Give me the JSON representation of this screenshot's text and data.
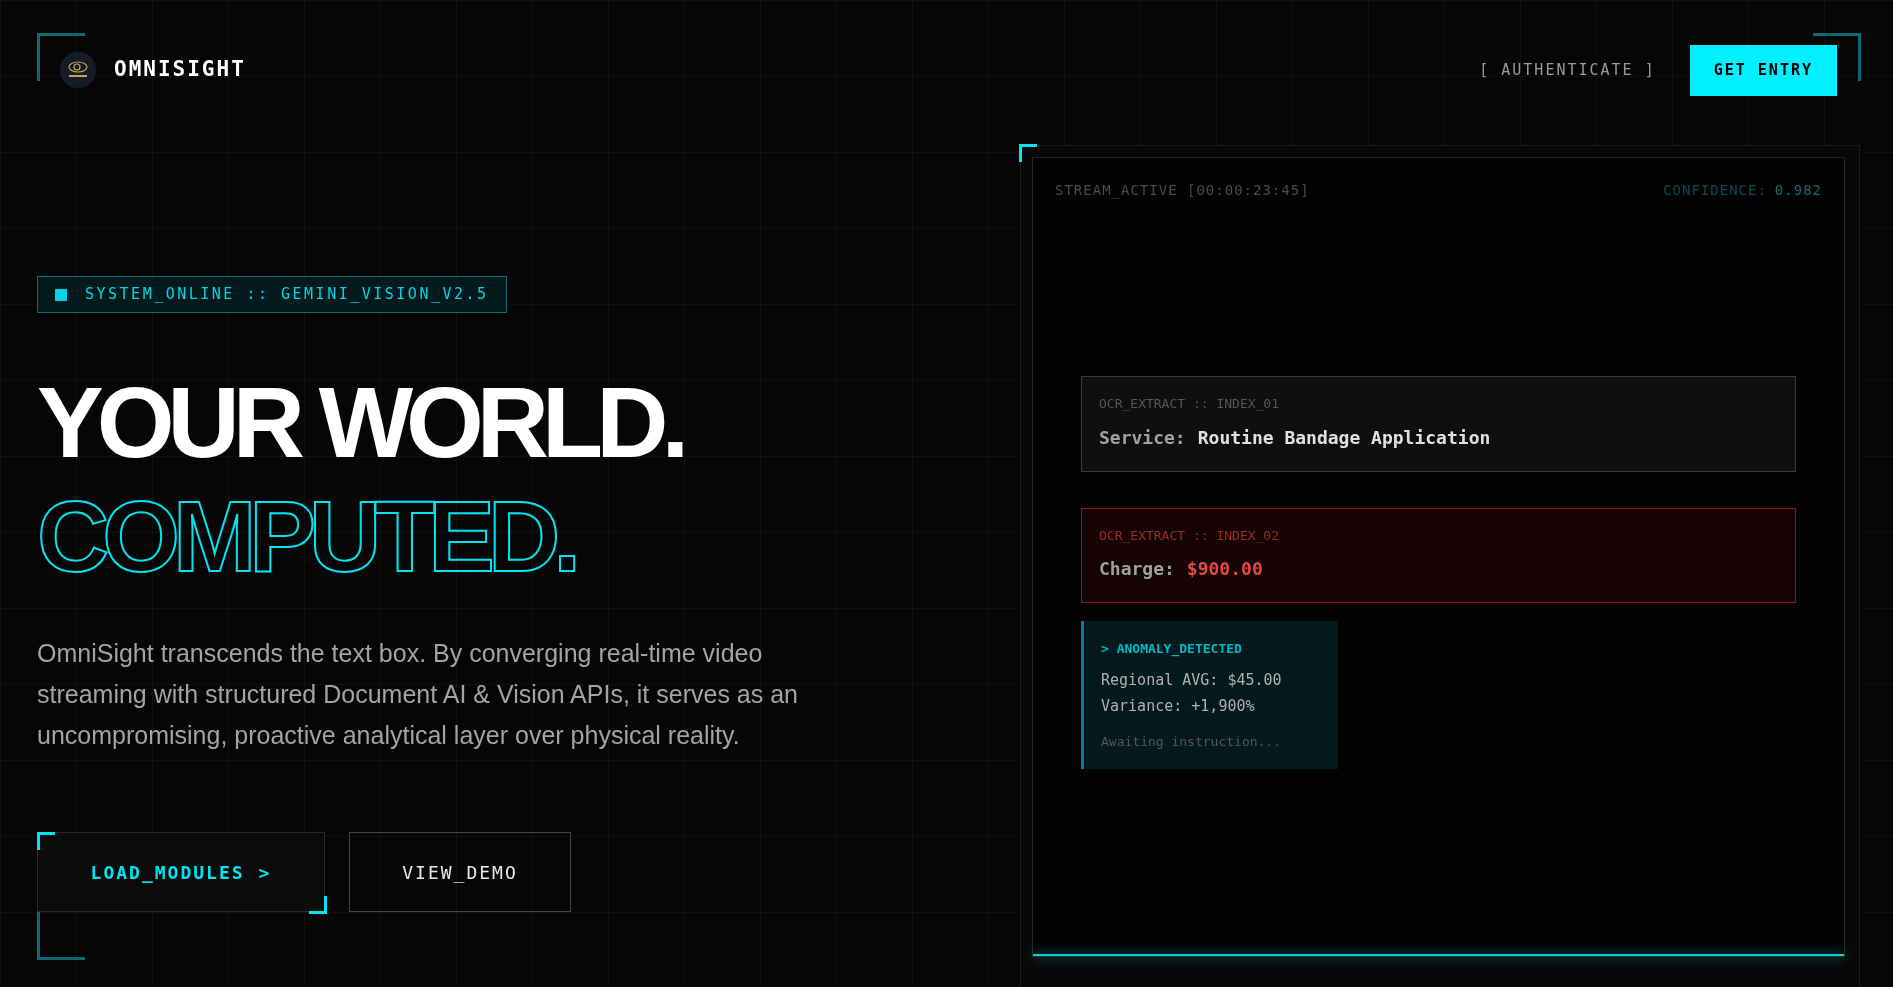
{
  "nav": {
    "brand": "OMNISIGHT",
    "links": [
      {
        "label": "[ AUTHENTICATE ]",
        "kind": "link"
      },
      {
        "label": "GET ENTRY",
        "kind": "primary"
      }
    ]
  },
  "hero": {
    "badge": "SYSTEM_ONLINE :: GEMINI_VISION_V2.5",
    "headline": [
      {
        "text": "YOUR WORLD.",
        "kind": "solid"
      },
      {
        "text": "COMPUTED.",
        "kind": "outline"
      }
    ],
    "description": "OmniSight transcends the text box. By converging real-time video streaming with structured Document AI & Vision APIs, it serves as an uncompromising, proactive analytical layer over physical reality.",
    "buttons": [
      {
        "label": "LOAD_MODULES",
        "icon": ">",
        "kind": "primary"
      },
      {
        "label": "VIEW_DEMO",
        "kind": "secondary"
      }
    ]
  },
  "stream": {
    "status": "STREAM_ACTIVE [00:00:23:45]",
    "confidence_label": "CONFIDENCE:",
    "confidence_value": "0.982",
    "extracts": [
      {
        "tag": "OCR_EXTRACT :: INDEX_01",
        "label": "Service:",
        "value": "Routine Bandage Application",
        "kind": "normal"
      },
      {
        "tag": "OCR_EXTRACT :: INDEX_02",
        "label": "Charge:",
        "value": "$900.00",
        "kind": "alert"
      }
    ],
    "anomaly": {
      "title": "> ANOMALY_DETECTED",
      "lines": [
        "Regional AVG: $45.00",
        "Variance: +1,900%"
      ],
      "footer": "Awaiting instruction..."
    }
  }
}
